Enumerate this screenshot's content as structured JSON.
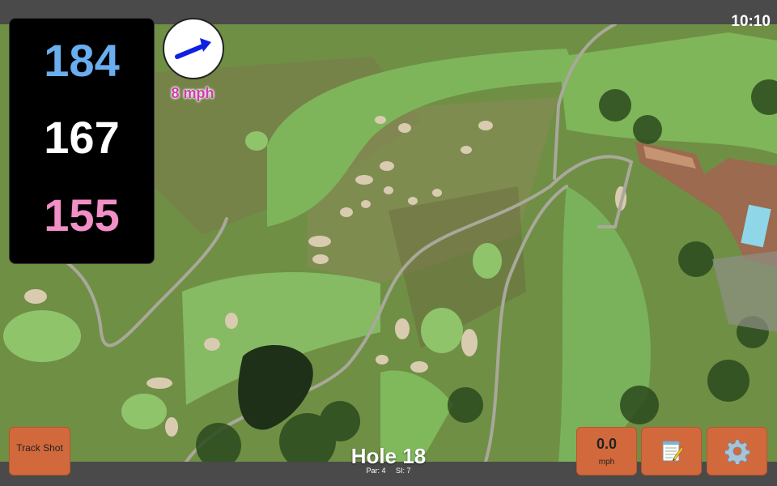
{
  "status_bar": {
    "time": "10:10"
  },
  "distances": {
    "back": "184",
    "center": "167",
    "front": "155"
  },
  "wind": {
    "speed": "8 mph",
    "direction_icon": "arrow-right-up-icon"
  },
  "buttons": {
    "track_shot": "Track Shot",
    "speed_value": "0.0",
    "speed_unit": "mph",
    "notes_icon": "notepad-icon",
    "settings_icon": "gear-icon"
  },
  "hole": {
    "title": "Hole 18",
    "par": "Par: 4",
    "si": "SI: 7"
  },
  "colors": {
    "back": "#6aaef0",
    "center": "#ffffff",
    "front": "#f28fc7",
    "wind_text": "#d03cb0",
    "button": "#d2693c"
  }
}
